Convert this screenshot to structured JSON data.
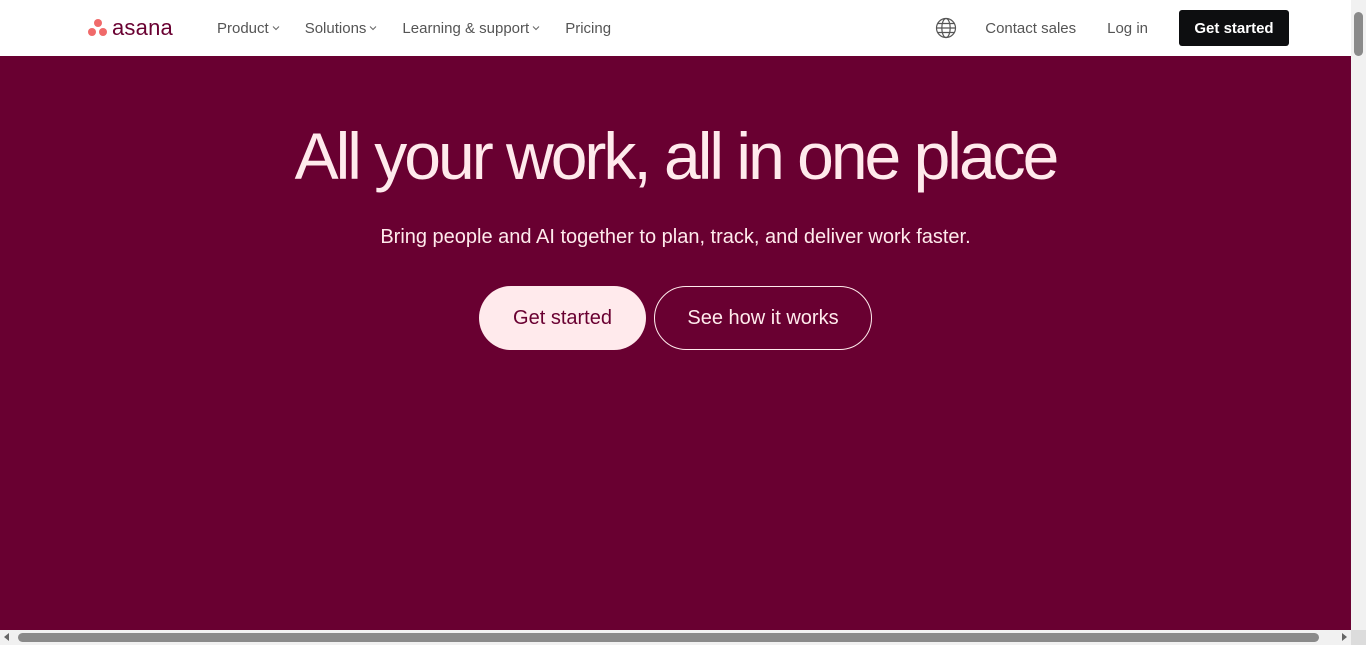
{
  "header": {
    "logo_text": "asana",
    "nav": [
      {
        "label": "Product",
        "has_dropdown": true
      },
      {
        "label": "Solutions",
        "has_dropdown": true
      },
      {
        "label": "Learning & support",
        "has_dropdown": true
      },
      {
        "label": "Pricing",
        "has_dropdown": false
      }
    ],
    "globe_icon": "globe-icon",
    "contact_sales": "Contact sales",
    "log_in": "Log in",
    "get_started": "Get started"
  },
  "hero": {
    "title": "All your work, all in one place",
    "subtitle": "Bring people and AI together to plan, track, and deliver work faster.",
    "primary_button": "Get started",
    "secondary_button": "See how it works"
  },
  "colors": {
    "hero_background": "#690031",
    "hero_text": "#ffeaec",
    "logo_mark": "#f06a6a",
    "header_cta_background": "#0d0e10"
  }
}
